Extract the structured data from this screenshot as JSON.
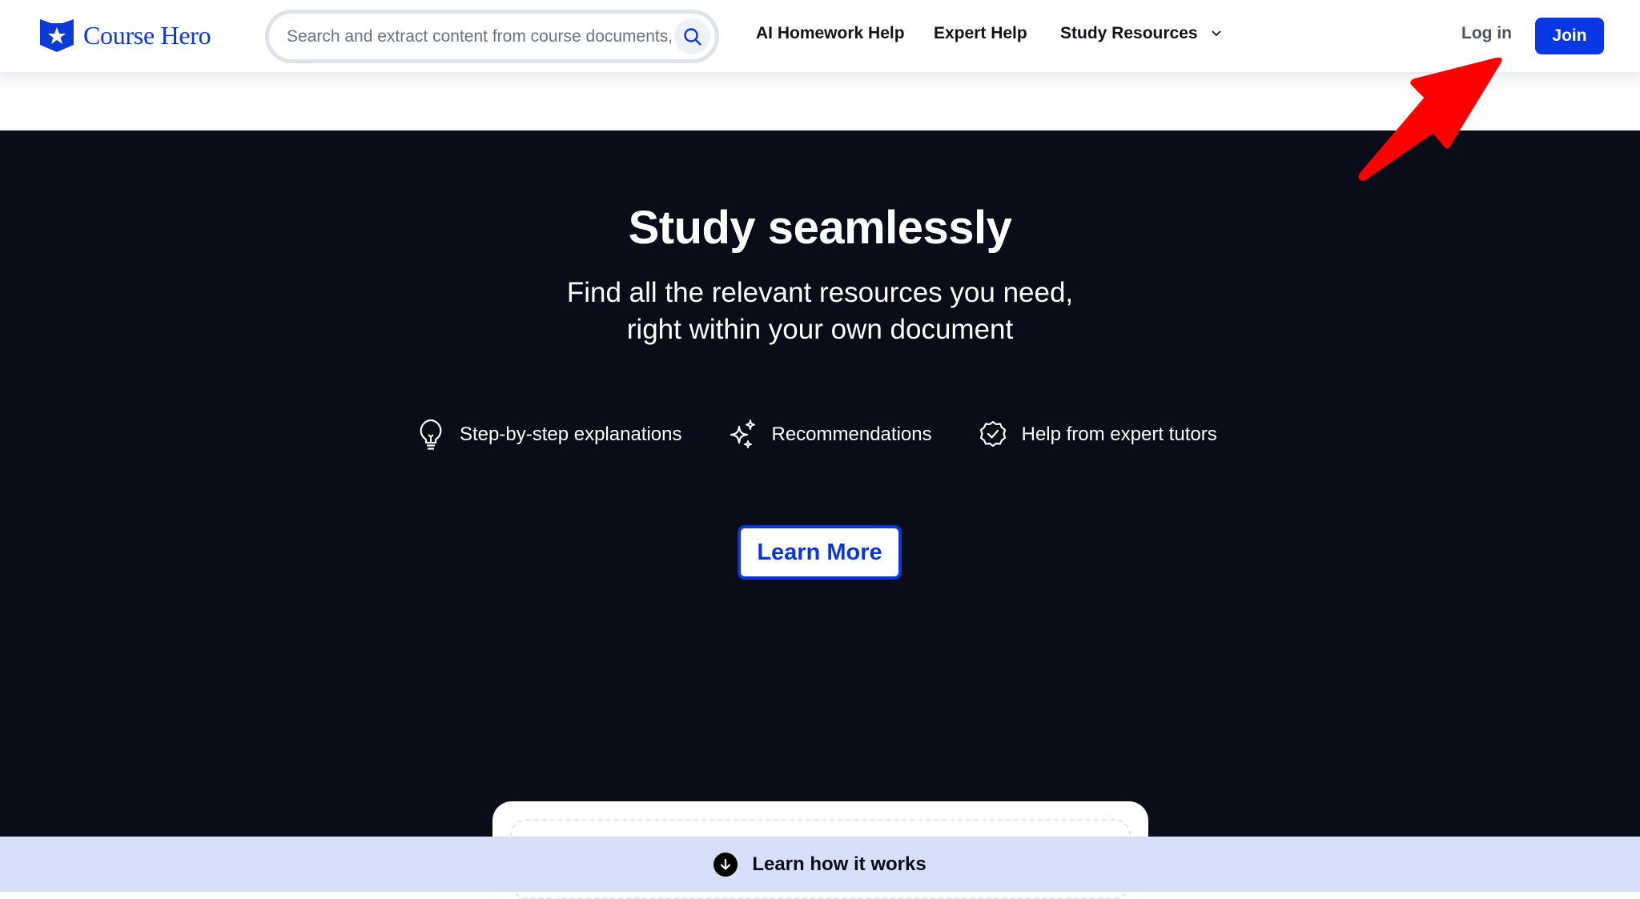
{
  "header": {
    "logo_text": "Course Hero",
    "search": {
      "placeholder": "Search and extract content from course documents, study guides and more",
      "icon": "search-icon"
    },
    "nav": [
      {
        "label": "AI Homework Help"
      },
      {
        "label": "Expert Help"
      },
      {
        "label": "Study Resources",
        "icon": "chevron-down-icon"
      }
    ],
    "login_label": "Log in",
    "join_label": "Join"
  },
  "hero": {
    "title": "Study seamlessly",
    "subtitle_line1": "Find all the relevant resources you need,",
    "subtitle_line2": "right within your own document",
    "features": [
      {
        "icon": "lightbulb-icon",
        "label": "Step-by-step explanations"
      },
      {
        "icon": "sparkles-icon",
        "label": "Recommendations"
      },
      {
        "icon": "verified-check-icon",
        "label": "Help from expert tutors"
      }
    ],
    "cta_label": "Learn More"
  },
  "bottom_bar": {
    "icon": "arrow-down-circle-icon",
    "label": "Learn how it works"
  },
  "colors": {
    "brand_blue": "#0a37e6",
    "hero_bg": "#0a0c19",
    "bottom_bar_bg": "#d6e0fb",
    "annotation_arrow": "#ff0000"
  }
}
